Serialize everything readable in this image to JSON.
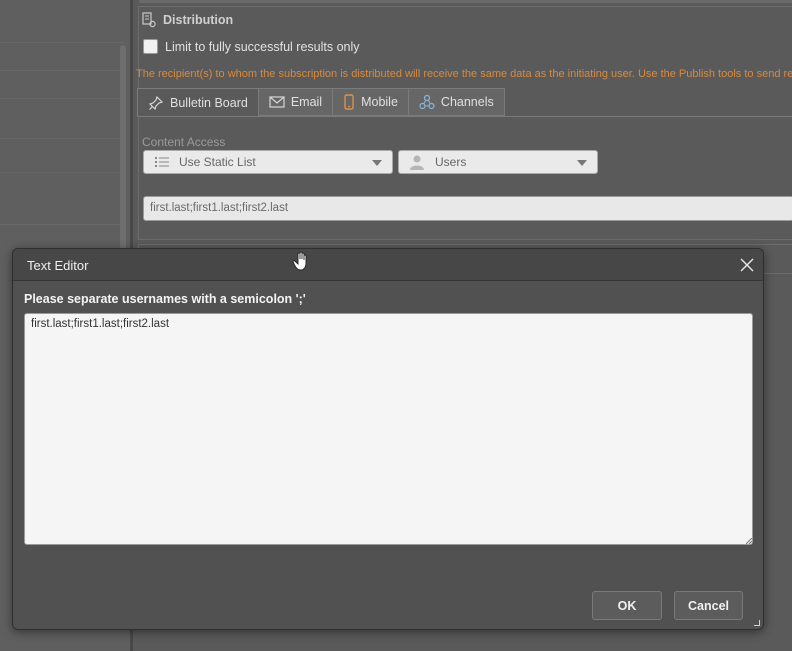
{
  "distribution": {
    "title": "Distribution",
    "limit_checkbox_label": "Limit to fully successful results only",
    "limit_checked": false,
    "warning_text": "The recipient(s) to whom the subscription is distributed will receive the same data as the initiating user. Use the Publish tools to send re",
    "tabs": [
      {
        "label": "Bulletin Board",
        "icon": "pin-icon",
        "active": true
      },
      {
        "label": "Email",
        "icon": "envelope-icon",
        "active": false
      },
      {
        "label": "Mobile",
        "icon": "phone-icon",
        "active": false
      },
      {
        "label": "Channels",
        "icon": "channels-icon",
        "active": false
      }
    ],
    "content_access_label": "Content Access",
    "list_select": {
      "value": "Use Static List",
      "icon": "list-icon"
    },
    "user_select": {
      "value": "Users",
      "icon": "user-icon"
    },
    "usernames_value": "first.last;first1.last;first2.last"
  },
  "dialog": {
    "title": "Text Editor",
    "instruction": "Please separate usernames with a semicolon ';'",
    "text_value": "first.last;first1.last;first2.last",
    "ok_label": "OK",
    "cancel_label": "Cancel"
  },
  "colors": {
    "warning": "#d98a3d",
    "dialog_bg": "#515151",
    "accent_icon": "#d8924a"
  }
}
